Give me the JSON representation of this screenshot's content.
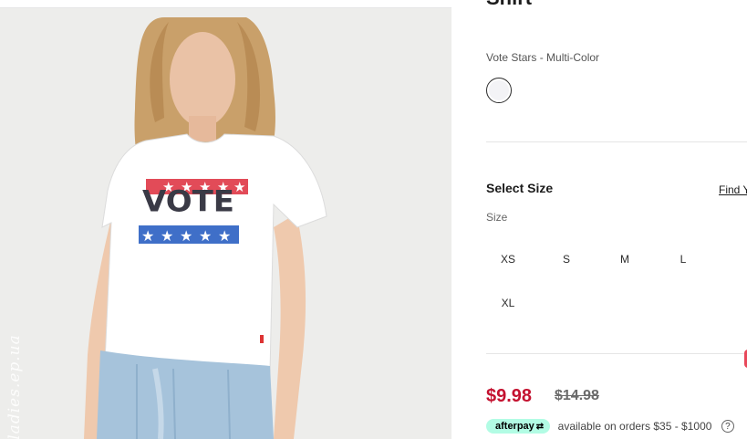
{
  "product": {
    "title_partial": "Shirt",
    "color_name": "Vote Stars - Multi-Color",
    "swatch_color": "#ffffff"
  },
  "size": {
    "heading": "Select Size",
    "find_link": "Find Y",
    "label": "Size",
    "options": [
      "XS",
      "S",
      "M",
      "L",
      "XL"
    ]
  },
  "price": {
    "sale": "$9.98",
    "original": "$14.98",
    "sale_color": "#c41230"
  },
  "afterpay": {
    "brand": "afterpay",
    "text": "available on orders $35 - $1000",
    "badge_color": "#b2fce4"
  },
  "image": {
    "shirt_text": "VOTE",
    "watermark": "ladies.ep.ua"
  }
}
